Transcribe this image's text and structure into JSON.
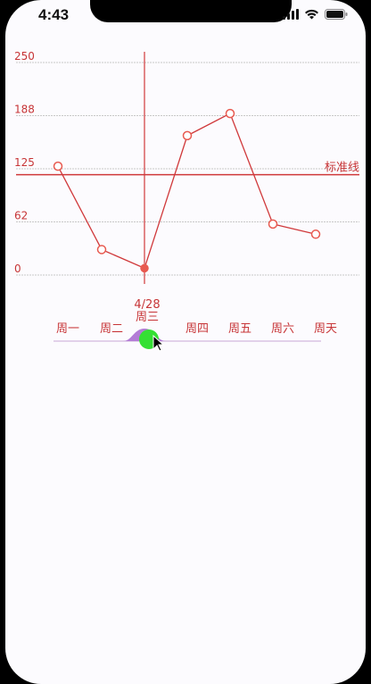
{
  "status_bar": {
    "time": "4:43",
    "icons": [
      "cellular-signal-icon",
      "wifi-icon",
      "battery-icon"
    ]
  },
  "chart_data": {
    "type": "line",
    "categories": [
      "周一",
      "周二",
      "周三",
      "周四",
      "周五",
      "周六",
      "周天"
    ],
    "values": [
      128,
      30,
      8,
      164,
      190,
      60,
      48
    ],
    "yticks": [
      "0",
      "62",
      "125",
      "188",
      "250"
    ],
    "ylim": [
      0,
      250
    ],
    "grid": true,
    "reference_line": {
      "value": 118,
      "label": "标准线"
    },
    "selected": {
      "index": 2,
      "date_label": "4/28",
      "day_label": "周三"
    },
    "colors": {
      "line": "#d0393b",
      "text": "#c73537",
      "grid": "#c8c8c8",
      "selected_point": "#e85a50",
      "bubble_fill": "#34e034",
      "slider_wave": "#b37cd6"
    }
  }
}
